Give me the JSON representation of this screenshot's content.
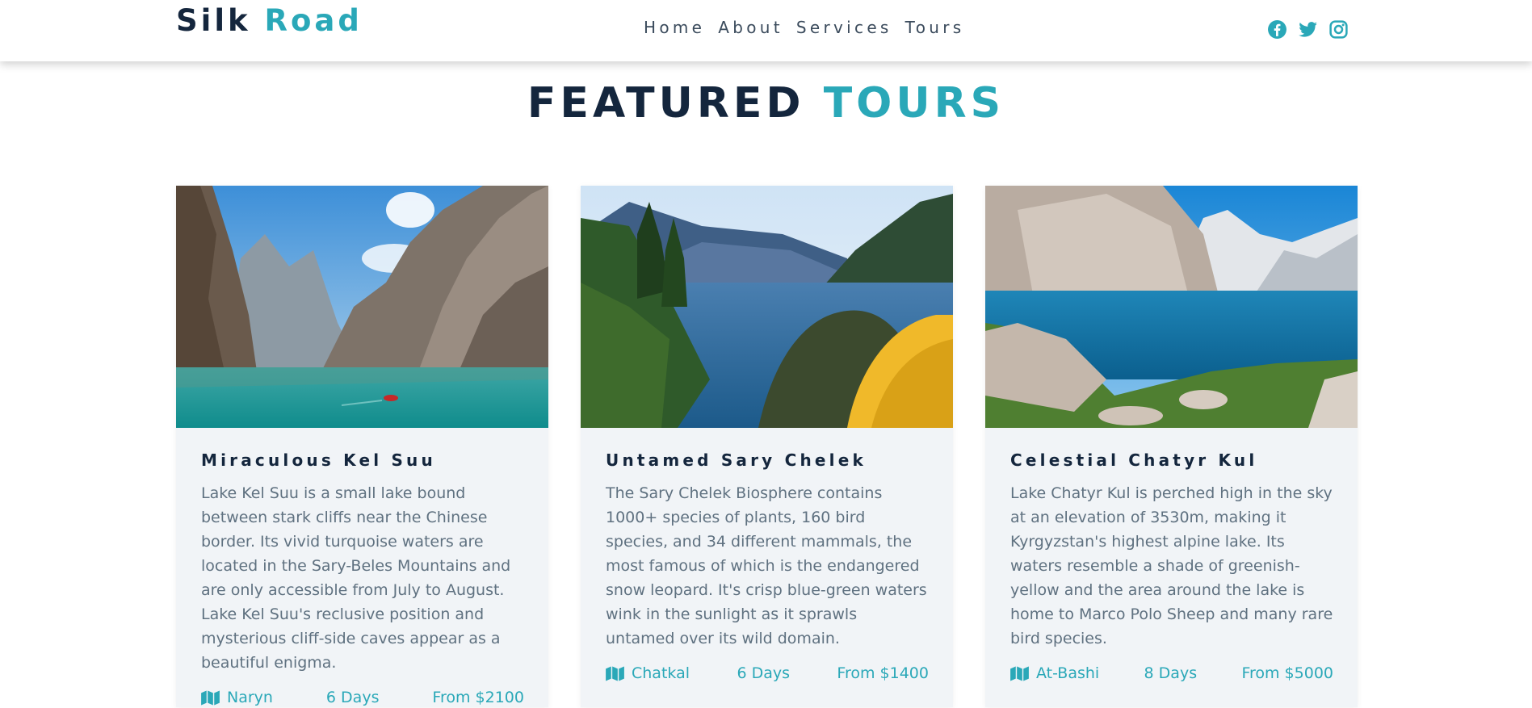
{
  "brand": {
    "part1": "Silk",
    "part2": "Road"
  },
  "nav": [
    {
      "label": "Home"
    },
    {
      "label": "About"
    },
    {
      "label": "Services"
    },
    {
      "label": "Tours"
    }
  ],
  "social": [
    "facebook-icon",
    "twitter-icon",
    "instagram-icon"
  ],
  "section": {
    "title_dark": "FEATURED",
    "title_accent": "TOURS"
  },
  "tours": [
    {
      "title": "Miraculous Kel Suu",
      "description": "Lake Kel Suu is a small lake bound between stark cliffs near the Chinese border. Its vivid turquoise waters are located in the Sary-Beles Mountains and are only accessible from July to August. Lake Kel Suu's reclusive position and mysterious cliff-side caves appear as a beautiful enigma.",
      "location": "Naryn",
      "duration": "6 Days",
      "price": "From $2100"
    },
    {
      "title": "Untamed Sary Chelek",
      "description": "The Sary Chelek Biosphere contains 1000+ species of plants, 160 bird species, and 34 different mammals, the most famous of which is the endangered snow leopard. It's crisp blue-green waters wink in the sunlight as it sprawls untamed over its wild domain.",
      "location": "Chatkal",
      "duration": "6 Days",
      "price": "From $1400"
    },
    {
      "title": "Celestial Chatyr Kul",
      "description": "Lake Chatyr Kul is perched high in the sky at an elevation of 3530m, making it Kyrgyzstan's highest alpine lake. Its waters resemble a shade of greenish-yellow and the area around the lake is home to Marco Polo Sheep and many rare bird species.",
      "location": "At-Bashi",
      "duration": "8 Days",
      "price": "From $5000"
    }
  ],
  "colors": {
    "accent": "#2aa8b8",
    "dark": "#14263d",
    "card_bg": "#f1f4f7",
    "text_muted": "#5f7180"
  }
}
